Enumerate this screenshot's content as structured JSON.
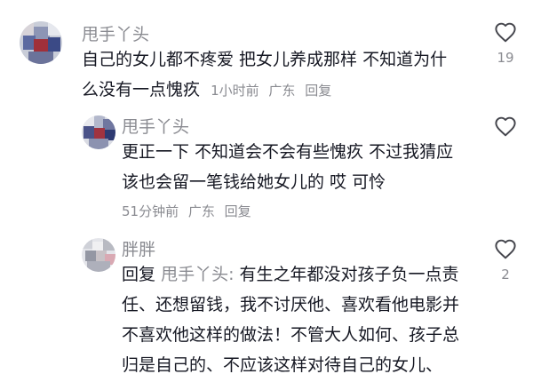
{
  "comments": [
    {
      "author": "甩手丫头",
      "line1": "自己的女儿都不疼爱  把女儿养成那样  不知道为什",
      "line2_text": "么没有一点愧疚",
      "time": "1小时前",
      "location": "广东",
      "reply_label": "回复",
      "likes": "19"
    },
    {
      "author": "甩手丫头",
      "line1": "更正一下  不知道会不会有些愧疚  不过我猜应",
      "line2": "该也会留一笔钱给她女儿的  哎  可怜",
      "time": "51分钟前",
      "location": "广东",
      "reply_label": "回复",
      "likes": ""
    },
    {
      "author": "胖胖",
      "reply_prefix": "回复",
      "reply_target": "甩手丫头:",
      "line1_rest": "有生之年都没对孩子负一点责",
      "line2": "任、还想留钱，我不讨厌他、喜欢看他电影并",
      "line3": "不喜欢他这样的做法！不管大人如何、孩子总",
      "line4": "归是自己的、不应该这样对待自己的女儿、",
      "likes": "2"
    }
  ],
  "colors": {
    "text": "#161823",
    "secondary": "#8a8b91",
    "background": "#ffffff"
  },
  "icons": {
    "like": "heart-outline-icon"
  }
}
